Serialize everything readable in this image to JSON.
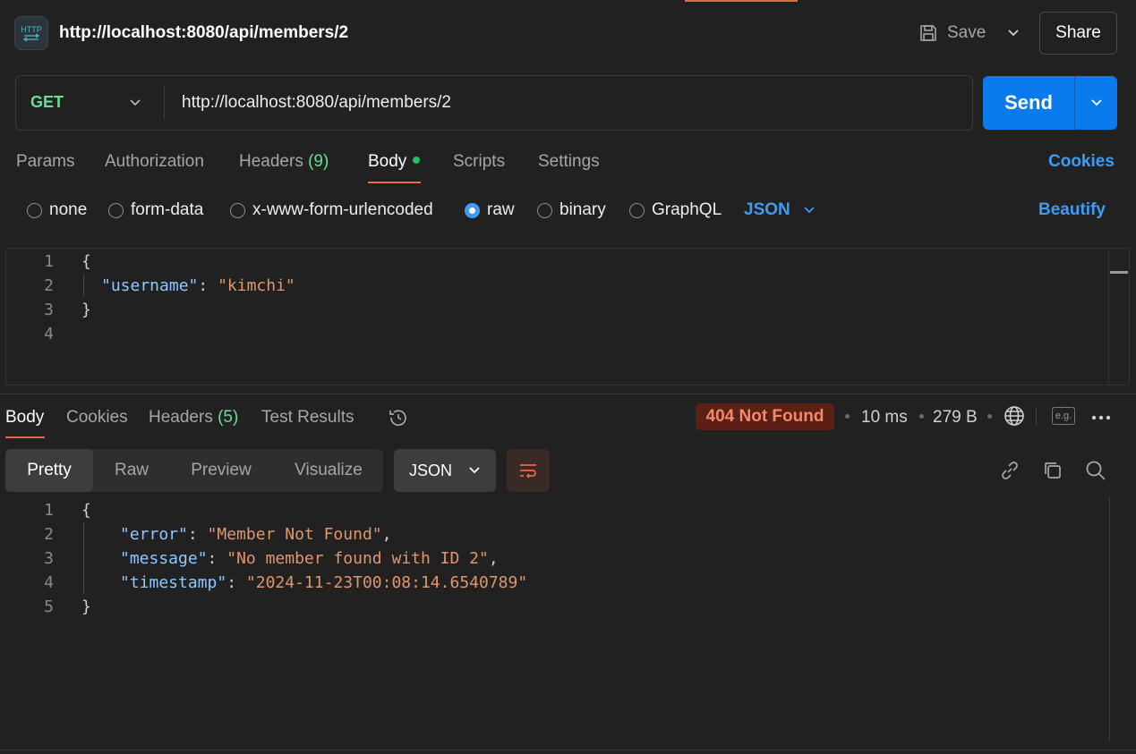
{
  "header": {
    "icon_label": "HTTP",
    "title": "http://localhost:8080/api/members/2",
    "save_label": "Save",
    "share_label": "Share"
  },
  "request": {
    "method": "GET",
    "url": "http://localhost:8080/api/members/2",
    "send_label": "Send",
    "tabs": [
      {
        "label": "Params"
      },
      {
        "label": "Authorization"
      },
      {
        "label": "Headers",
        "count": "(9)"
      },
      {
        "label": "Body",
        "active": true
      },
      {
        "label": "Scripts"
      },
      {
        "label": "Settings"
      }
    ],
    "cookies_label": "Cookies",
    "body_types": [
      "none",
      "form-data",
      "x-www-form-urlencoded",
      "raw",
      "binary",
      "GraphQL"
    ],
    "selected_body_type": "raw",
    "body_language": "JSON",
    "beautify_label": "Beautify",
    "line_numbers": [
      "1",
      "2",
      "3",
      "4"
    ],
    "body_lines": {
      "open": "{",
      "key": "\"username\"",
      "colon": ": ",
      "value": "\"kimchi\"",
      "close": "}"
    }
  },
  "response": {
    "tabs": [
      {
        "label": "Body",
        "active": true
      },
      {
        "label": "Cookies"
      },
      {
        "label": "Headers",
        "count": "(5)"
      },
      {
        "label": "Test Results"
      }
    ],
    "status": "404 Not Found",
    "time": "10 ms",
    "size": "279 B",
    "eg_label": "e.g.",
    "views": [
      "Pretty",
      "Raw",
      "Preview",
      "Visualize"
    ],
    "active_view": "Pretty",
    "format": "JSON",
    "line_numbers": [
      "1",
      "2",
      "3",
      "4",
      "5"
    ],
    "body_lines": {
      "open": "{",
      "error_key": "\"error\"",
      "error_value": "\"Member Not Found\"",
      "message_key": "\"message\"",
      "message_value": "\"No member found with ID 2\"",
      "timestamp_key": "\"timestamp\"",
      "timestamp_value": "\"2024-11-23T00:08:14.6540789\"",
      "close": "}"
    }
  },
  "colors": {
    "accent": "#e8694a",
    "send": "#097bed",
    "link": "#3e9cf5",
    "method_get": "#6bdd9a",
    "status_bg": "#5c1f15",
    "status_text": "#f08a6b",
    "json_key": "#8cc8ff",
    "json_string": "#e2956c"
  },
  "icons": [
    "http-icon",
    "save-icon",
    "chevron-down-icon",
    "history-icon",
    "globe-icon",
    "more-icon",
    "wrap-icon",
    "link-icon",
    "copy-icon",
    "search-icon"
  ]
}
